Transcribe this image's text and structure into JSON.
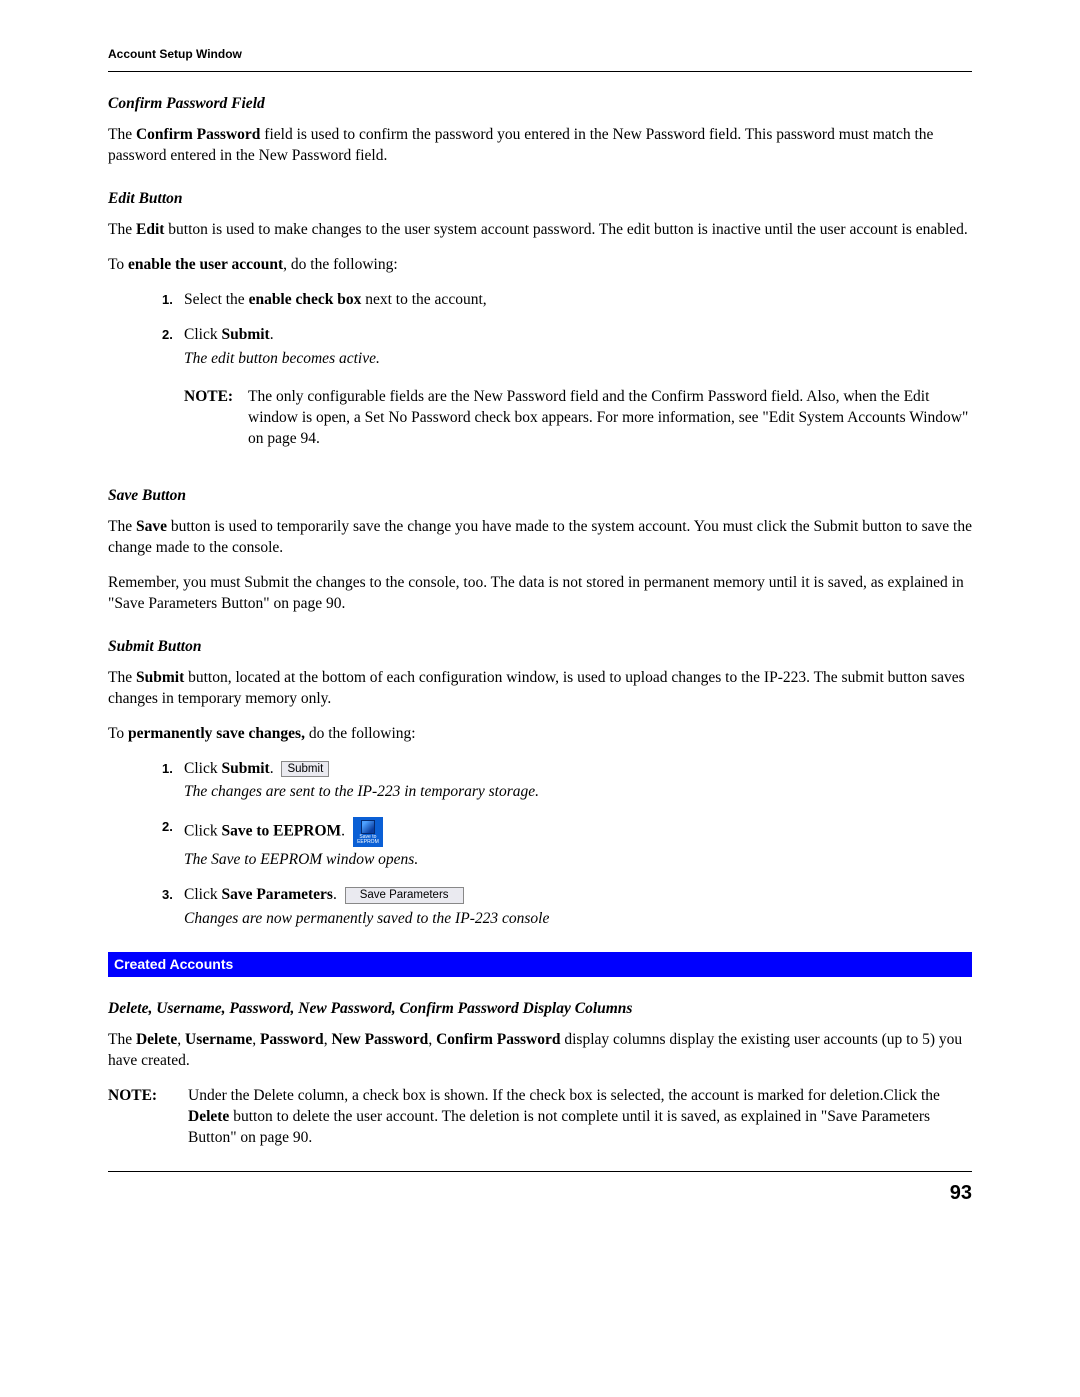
{
  "header": {
    "title": "Account Setup Window"
  },
  "confirm_pw": {
    "heading": "Confirm Password Field",
    "p1_a": "The ",
    "p1_bold": "Confirm Password",
    "p1_b": " field is used to confirm the password you entered in the New Password field. This password must match the password entered in the New Password field."
  },
  "edit_btn": {
    "heading": "Edit Button",
    "p1_a": "The ",
    "p1_bold": "Edit",
    "p1_b": " button is used to make changes to the user system account password. The edit button is inactive until the user account is enabled.",
    "p2_a": "To ",
    "p2_bold": "enable the user account",
    "p2_b": ", do the following:",
    "steps": {
      "s1_a": "Select the ",
      "s1_bold": "enable check box",
      "s1_b": " next to the account,",
      "s2_a": "Click ",
      "s2_bold": "Submit",
      "s2_b": ".",
      "s2_italic": "The edit button becomes active."
    },
    "note_label": "NOTE:",
    "note_body": "The only configurable fields are the New Password field and the Confirm Password field. Also, when the Edit window is open, a Set No Password check box appears. For more information, see \"Edit System Accounts Window\" on page 94."
  },
  "save_btn": {
    "heading": "Save Button",
    "p1_a": "The ",
    "p1_bold": "Save",
    "p1_b": " button is used to temporarily save the change you have made to the system account. You must click the Submit button to save the change made to the console.",
    "p2": "Remember, you must Submit the changes to the console, too. The data is not stored in permanent memory until it is saved, as explained in \"Save Parameters Button\" on page 90."
  },
  "submit_btn": {
    "heading": "Submit Button",
    "p1_a": "The ",
    "p1_bold": "Submit",
    "p1_b": " button, located at the bottom of each configuration window, is used to upload changes to the IP-223. The submit button saves changes in temporary memory only.",
    "p2_a": "To ",
    "p2_bold": "permanently save changes,",
    "p2_b": " do the following:",
    "steps": {
      "s1_a": "Click ",
      "s1_bold": "Submit",
      "s1_b": ". ",
      "s1_btn": "Submit",
      "s1_italic": "The changes are sent to the IP-223 in temporary storage.",
      "s2_a": "Click ",
      "s2_bold": "Save to EEPROM",
      "s2_b": ". ",
      "s2_icon_top": "Save to",
      "s2_icon_bot": "EEPROM",
      "s2_italic": "The Save to EEPROM window opens.",
      "s3_a": "Click ",
      "s3_bold": "Save Parameters",
      "s3_b": ". ",
      "s3_btn": "Save Parameters",
      "s3_italic": "Changes are now permanently saved to the IP-223 console"
    }
  },
  "created": {
    "banner": "Created Accounts",
    "heading": "Delete, Username, Password, New Password, Confirm Password Display Columns",
    "p1_a": "The ",
    "p1_b1": "Delete",
    "p1_c1": ", ",
    "p1_b2": "Username",
    "p1_c2": ", ",
    "p1_b3": "Password",
    "p1_c3": ", ",
    "p1_b4": "New Password",
    "p1_c4": ", ",
    "p1_b5": "Confirm Password",
    "p1_b": " display columns display the existing user accounts (up to 5) you have created.",
    "note_label": "NOTE:",
    "note_a": "Under the Delete column, a check box is shown. If the check box is selected, the account is marked for deletion.Click the ",
    "note_bold": "Delete",
    "note_b": " button to delete the user account. The deletion is not complete until it is saved, as explained in \"Save Parameters Button\" on page 90."
  },
  "page_number": "93"
}
